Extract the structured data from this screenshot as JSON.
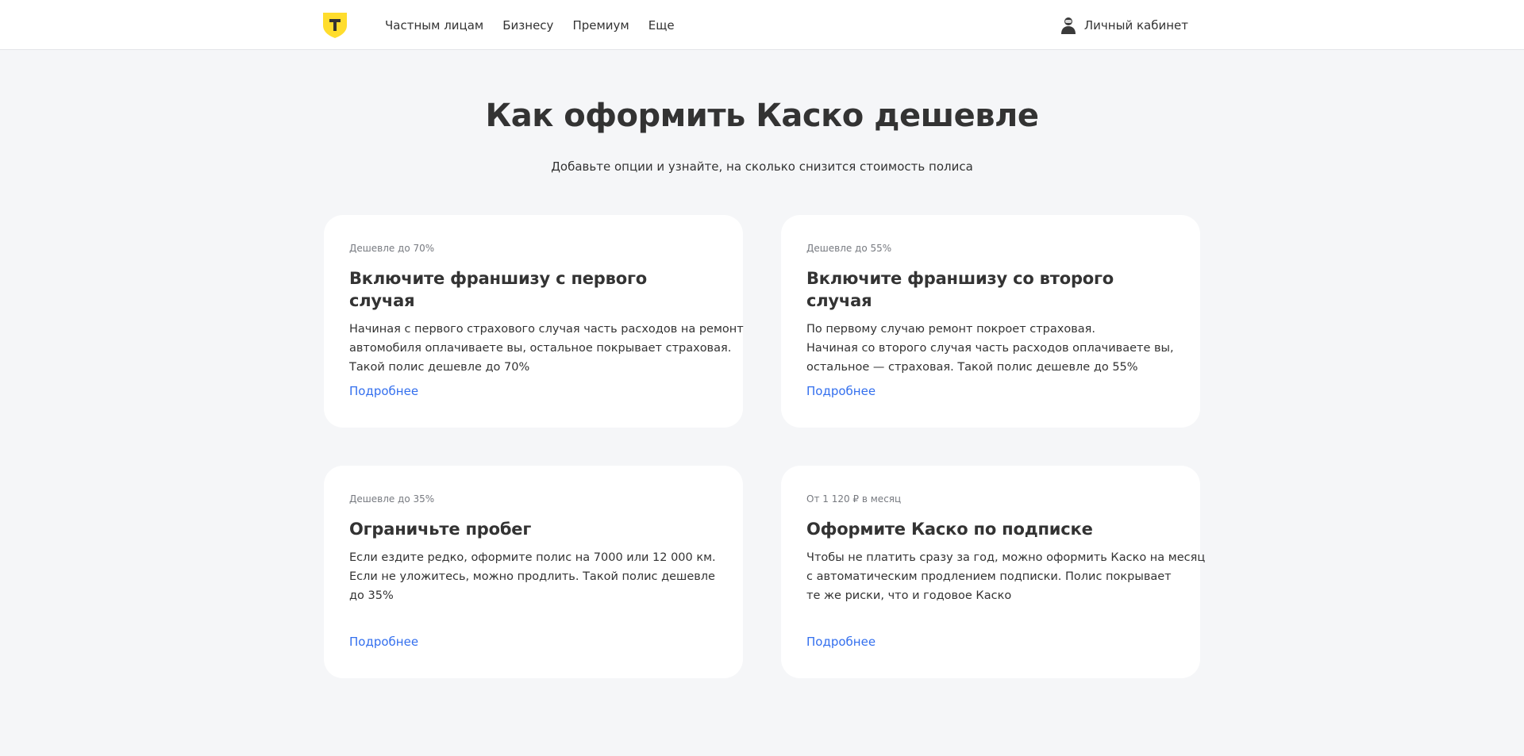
{
  "header": {
    "nav": [
      "Частным лицам",
      "Бизнесу",
      "Премиум",
      "Еще"
    ],
    "account_label": "Личный кабинет",
    "logo_icon": "shield-logo-icon",
    "account_icon": "user-icon",
    "brand_color": "#ffdd2d"
  },
  "hero": {
    "title": "Как оформить Каско дешевле",
    "subtitle": "Добавьте опции и узнайте, на сколько снизится стоимость полиса"
  },
  "cards": [
    {
      "badge": "Дешевле до 70%",
      "title": "Включите франшизу с первого случая",
      "lines": [
        "Начиная с первого страхового случая часть расходов на ремонт",
        "автомобиля оплачиваете вы, остальное покрывает страховая.",
        "Такой полис дешевле до 70%"
      ],
      "link": "Подробнее"
    },
    {
      "badge": "Дешевле до 55%",
      "title": "Включите франшизу со второго случая",
      "lines": [
        "По первому случаю ремонт покроет страховая.",
        "Начиная со второго случая часть расходов оплачиваете вы,",
        "остальное — страховая. Такой полис дешевле до 55%"
      ],
      "link": "Подробнее"
    },
    {
      "badge": "Дешевле до 35%",
      "title": "Ограничьте пробег",
      "lines": [
        "Если ездите редко, оформите полис на 7000 или 12 000 км.",
        "Если не уложитесь, можно продлить. Такой полис дешевле",
        "до 35%"
      ],
      "link": "Подробнее"
    },
    {
      "badge": "От 1 120 ₽ в месяц",
      "title": "Оформите Каско по подписке",
      "lines": [
        "Чтобы не платить сразу за год, можно оформить Каско на месяц",
        "с автоматическим продлением подписки. Полис покрывает",
        "те же риски, что и годовое Каско"
      ],
      "link": "Подробнее"
    }
  ],
  "colors": {
    "page_background": "#f5f6f8",
    "card_background": "#ffffff",
    "link": "#336fee",
    "text": "#333333",
    "muted": "#777a80"
  }
}
